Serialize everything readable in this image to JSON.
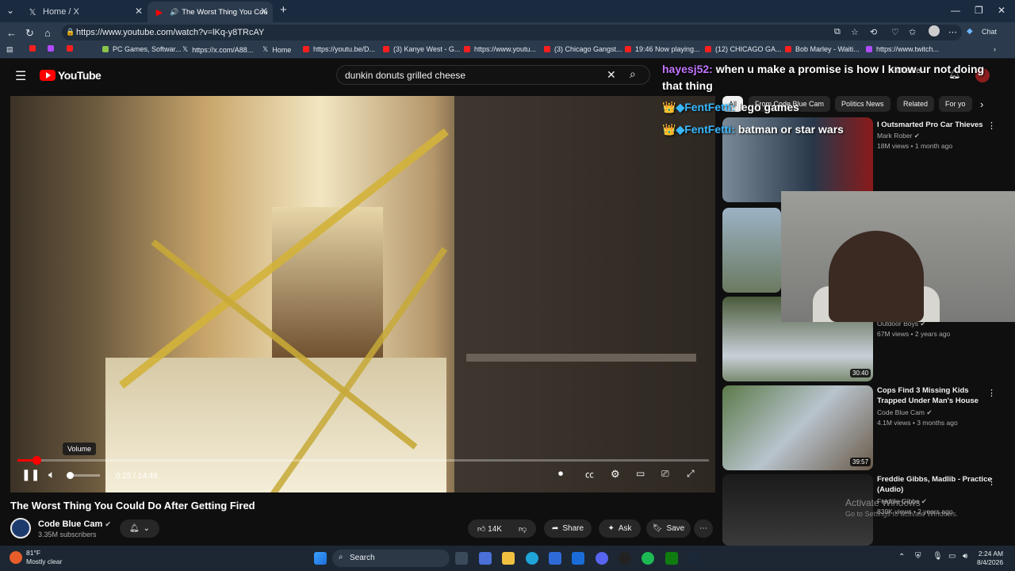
{
  "browser": {
    "tabs": [
      {
        "title": "Home / X",
        "active": false
      },
      {
        "title": "The Worst Thing You Could D",
        "active": true
      }
    ],
    "url": "https://www.youtube.com/watch?v=lKq-y8TRcAY",
    "chat_label": "Chat",
    "bookmarks": [
      "",
      "",
      "",
      "PC Games, Softwar...",
      "https://x.com/A88...",
      "Home",
      "https://youtu.be/D...",
      "(3) Kanye West - G...",
      "https://www.youtu...",
      "(3) Chicago Gangst...",
      "19:46 Now playing...",
      "(12) CHICAGO GA...",
      "Bob Marley - Waiti...",
      "https://www.twitch..."
    ]
  },
  "youtube": {
    "logo": "YouTube",
    "search_value": "dunkin donuts grilled cheese",
    "create_label": "Create",
    "chips": [
      "All",
      "From Code Blue Cam",
      "Politics News",
      "Related",
      "For yo"
    ],
    "player": {
      "volume_tooltip": "Volume",
      "time": "0:25 / 14:49",
      "progress_fraction": 0.028
    },
    "video_title": "The Worst Thing You Could Do After Getting Fired",
    "channel": {
      "name": "Code Blue Cam",
      "subs": "3.35M subscribers"
    },
    "actions": {
      "likes": "14K",
      "share": "Share",
      "ask": "Ask",
      "save": "Save"
    },
    "recommendations": [
      {
        "title": "I Outsmarted Pro Car Thieves",
        "channel": "Mark Rober",
        "meta": "18M views • 1 month ago",
        "duration": ""
      },
      {
        "title": "",
        "channel": "Outdoor Boys",
        "meta": "67M views • 2 years ago",
        "duration": "30:40"
      },
      {
        "title": "Cops Find 3 Missing Kids Trapped Under Man's House",
        "channel": "Code Blue Cam",
        "meta": "4.1M views • 3 months ago",
        "duration": "39:57"
      },
      {
        "title": "Freddie Gibbs, Madlib - Practice (Audio)",
        "channel": "Freddie Gibbs",
        "meta": "839K views • 2 years ago",
        "duration": ""
      }
    ]
  },
  "chat_overlay": [
    {
      "user": "hayesj52:",
      "text": " when u make a promise is how I know ur not doing"
    },
    {
      "user": "",
      "text": "that thing"
    },
    {
      "user": "FentFetti:",
      "text": " lego games"
    },
    {
      "user": "FentFetti:",
      "text": " batman or star wars"
    }
  ],
  "watermark": {
    "line1": "Activate Windows",
    "line2": "Go to Settings to activate Windows."
  },
  "taskbar": {
    "weather_temp": "81°F",
    "weather_desc": "Mostly clear",
    "search": "Search",
    "time": "2:24 AM",
    "date": "8/4/2026"
  },
  "colors": {
    "youtube_red": "#ff0000",
    "chat_user_purple": "#c275ff",
    "chat_user_blue": "#3ab8ff"
  }
}
